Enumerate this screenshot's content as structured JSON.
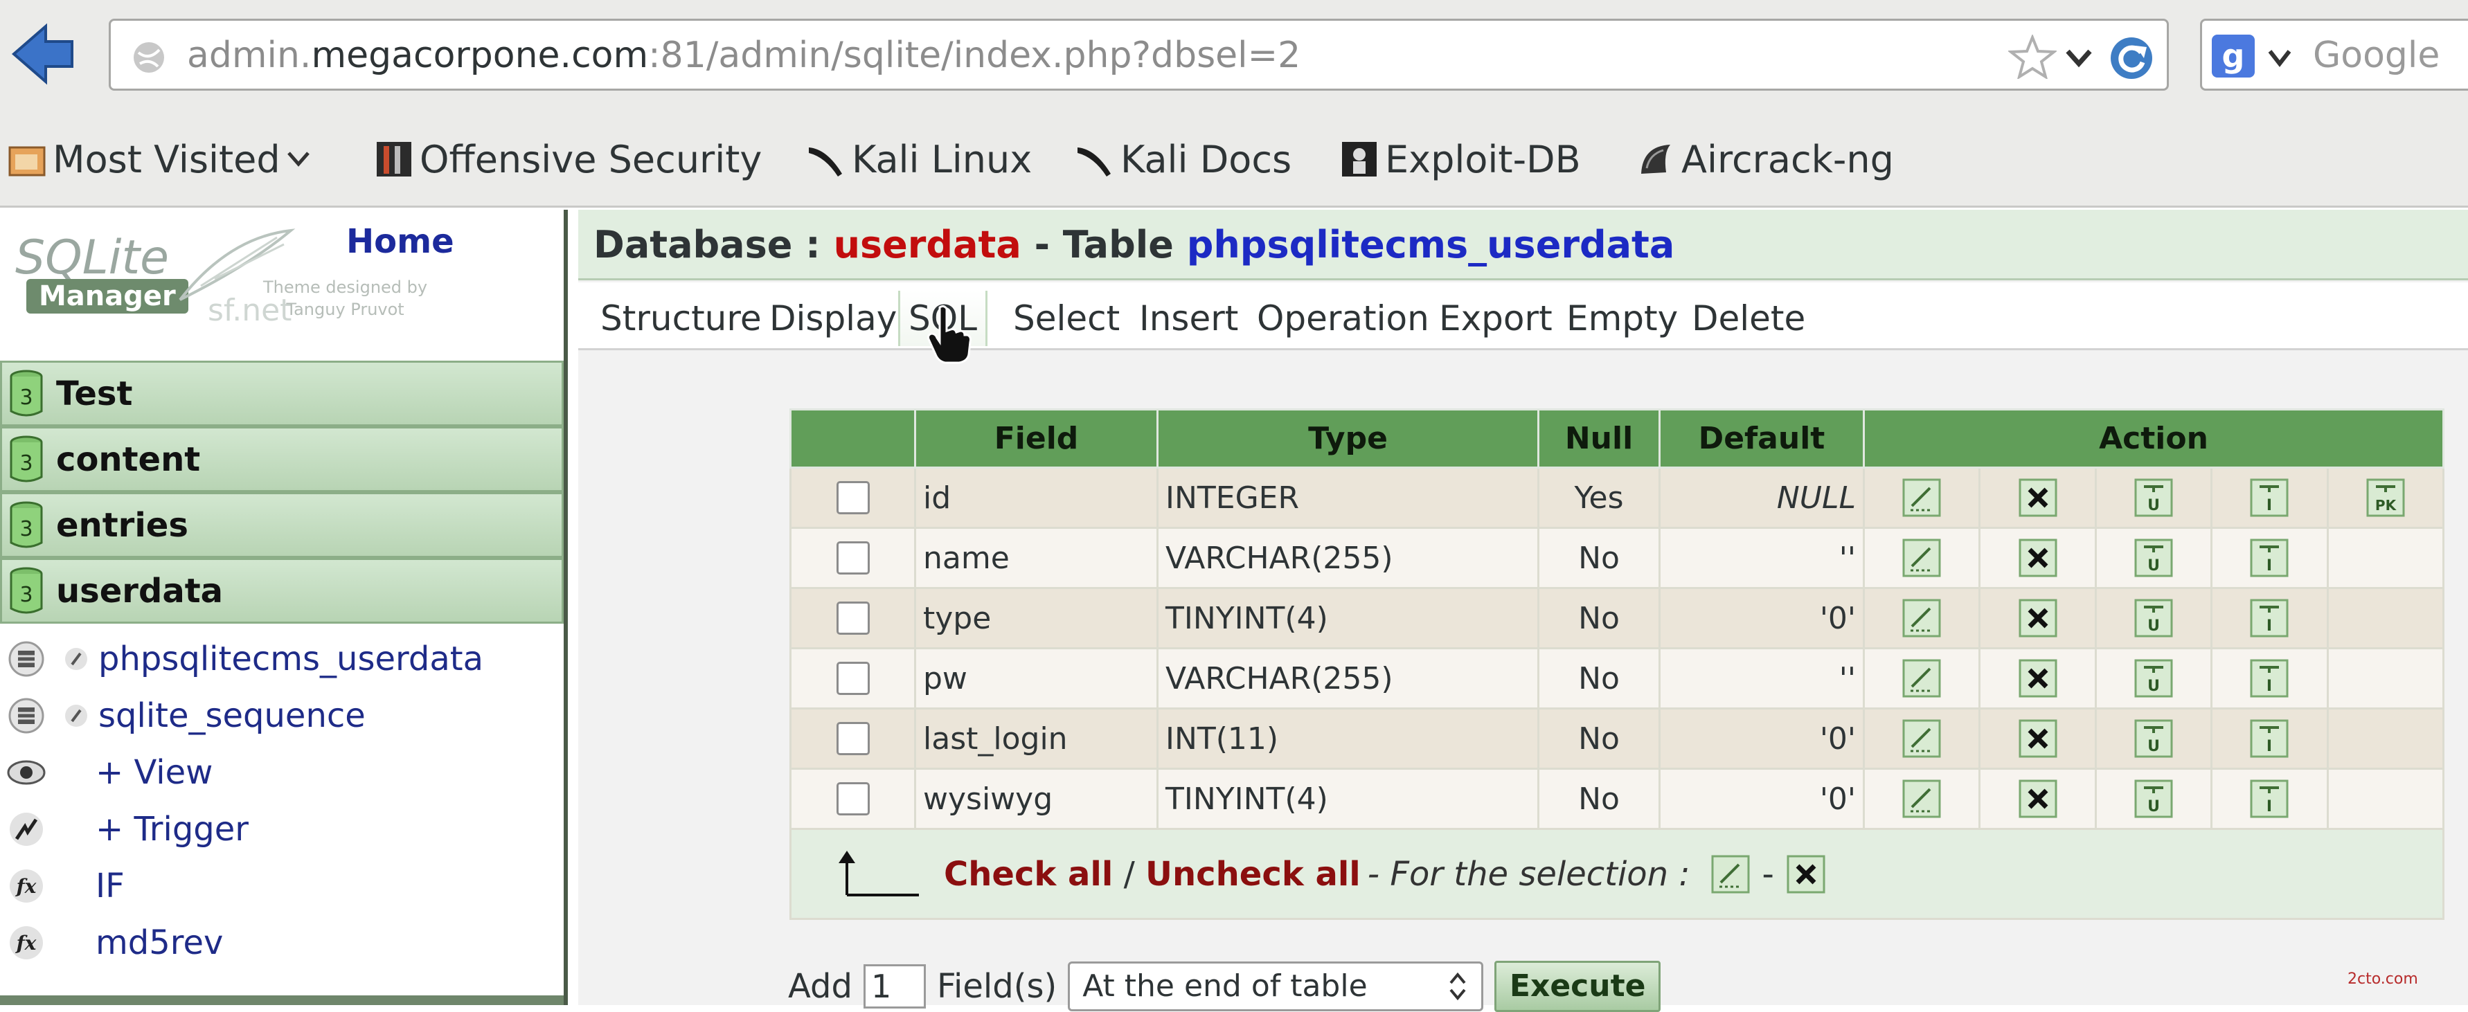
{
  "browser": {
    "url_prefix": "admin.",
    "url_domain": "megacorpone.com",
    "url_rest": ":81/admin/sqlite/index.php?dbsel=2",
    "search_placeholder": "Google",
    "search_engine_letter": "g",
    "bookmarks": [
      {
        "label": "Most Visited",
        "icon": "folder-icon"
      },
      {
        "label": "Offensive Security",
        "icon": "offsec-icon"
      },
      {
        "label": "Kali Linux",
        "icon": "kali-icon"
      },
      {
        "label": "Kali Docs",
        "icon": "kali-icon"
      },
      {
        "label": "Exploit-DB",
        "icon": "exploitdb-icon"
      },
      {
        "label": "Aircrack-ng",
        "icon": "aircrack-icon"
      }
    ]
  },
  "sidebar": {
    "logo_text": "SQLite",
    "logo_manager": "Manager",
    "logo_sf": "sf.net",
    "logo_credit_1": "Theme designed by",
    "logo_credit_2": "Tanguy Pruvot",
    "home_label": "Home",
    "db_icon_number": "3",
    "databases": [
      "Test",
      "content",
      "entries",
      "userdata"
    ],
    "tree": [
      {
        "label": "phpsqlitecms_userdata",
        "icon": "table-icon"
      },
      {
        "label": "sqlite_sequence",
        "icon": "table-icon"
      },
      {
        "label": "+ View",
        "icon": "eye-icon"
      },
      {
        "label": "+ Trigger",
        "icon": "trigger-icon"
      },
      {
        "label": "IF",
        "icon": "function-icon"
      },
      {
        "label": "md5rev",
        "icon": "function-icon"
      }
    ]
  },
  "main": {
    "title_db_prefix": "Database : ",
    "title_db_name": "userdata",
    "title_table_prefix": " - Table ",
    "title_table_name": "phpsqlitecms_userdata",
    "tabs": [
      "Structure",
      "Display",
      "SQL",
      "Select",
      "Insert",
      "Operation",
      "Export",
      "Empty",
      "Delete"
    ],
    "active_tab": "SQL",
    "columns": [
      "Field",
      "Type",
      "Null",
      "Default",
      "Action"
    ],
    "rows": [
      {
        "field": "id",
        "type": "INTEGER",
        "null": "Yes",
        "default": "NULL",
        "pk": true
      },
      {
        "field": "name",
        "type": "VARCHAR(255)",
        "null": "No",
        "default": "''",
        "pk": false
      },
      {
        "field": "type",
        "type": "TINYINT(4)",
        "null": "No",
        "default": "'0'",
        "pk": false
      },
      {
        "field": "pw",
        "type": "VARCHAR(255)",
        "null": "No",
        "default": "''",
        "pk": false
      },
      {
        "field": "last_login",
        "type": "INT(11)",
        "null": "No",
        "default": "'0'",
        "pk": false
      },
      {
        "field": "wysiwyg",
        "type": "TINYINT(4)",
        "null": "No",
        "default": "'0'",
        "pk": false
      }
    ],
    "action_icons": [
      "edit-icon",
      "delete-icon",
      "unique-index-icon",
      "index-icon",
      "primary-key-icon"
    ],
    "pk_icon_text": "PK",
    "unique_icon_text": "U",
    "index_icon_text": "I",
    "check_all": "Check all",
    "separator": " / ",
    "uncheck_all": "Uncheck all",
    "for_selection": "- For the selection :",
    "selection_dash": "-",
    "add_label": "Add",
    "add_count": "1",
    "fields_label": "Field(s)",
    "position_value": "At the end of table",
    "execute_label": "Execute",
    "watermark": "2cto.com"
  },
  "colors": {
    "accent_green": "#619e59",
    "db_name_red": "#c20d0d",
    "table_name_blue": "#1c2ac4",
    "link_dark_red": "#8b0f0f"
  }
}
